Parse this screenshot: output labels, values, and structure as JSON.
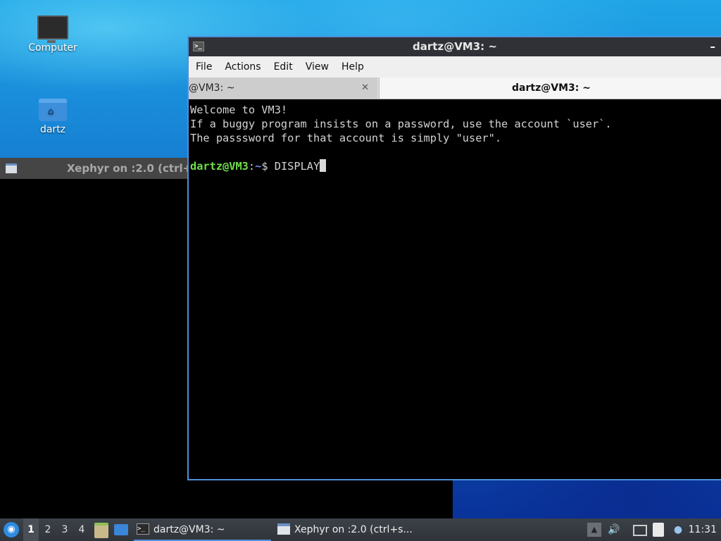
{
  "desktop": {
    "icons": [
      {
        "label": "Computer",
        "icon": "monitor-icon"
      },
      {
        "label": "dartz",
        "icon": "home-folder-icon"
      }
    ]
  },
  "xephyr_window": {
    "title": "Xephyr on :2.0 (ctrl+"
  },
  "terminal_window": {
    "title": "dartz@VM3: ~",
    "minimize_glyph": "–",
    "menu": [
      "File",
      "Actions",
      "Edit",
      "View",
      "Help"
    ],
    "tabs": [
      {
        "label": "@VM3: ~",
        "active": false
      },
      {
        "label": "dartz@VM3: ~",
        "active": true
      }
    ],
    "tab_close_glyph": "✕",
    "lines": [
      "Welcome to VM3!",
      "If a buggy program insists on a password, use the account `user`.",
      "The passsword for that account is simply \"user\".",
      ""
    ],
    "prompt": {
      "user_host": "dartz@VM3",
      "colon": ":",
      "path": "~",
      "symbol": "$ ",
      "command": "DISPLAY"
    },
    "colors": {
      "prompt_user": "#6ee04a",
      "prompt_path": "#6b8ff5",
      "accent_border": "#4f8fd8"
    }
  },
  "taskbar": {
    "workspaces": [
      "1",
      "2",
      "3",
      "4"
    ],
    "active_workspace": "1",
    "tasks": [
      {
        "label": "dartz@VM3: ~",
        "icon": "terminal-icon",
        "active": true
      },
      {
        "label": "Xephyr on :2.0 (ctrl+s...",
        "icon": "window-icon",
        "active": false
      }
    ],
    "tray_icons": [
      "eject-icon",
      "volume-icon",
      "network-icon",
      "clipboard-icon",
      "update-notifier-icon"
    ],
    "clock": "11:31"
  }
}
